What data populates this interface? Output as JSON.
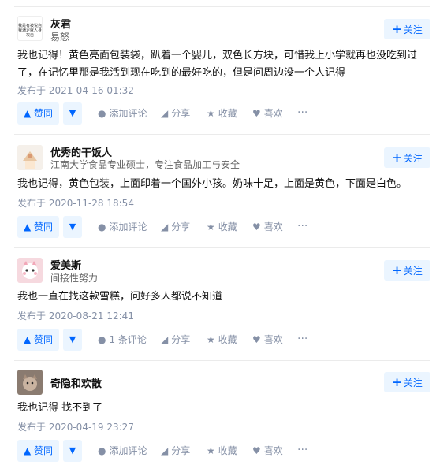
{
  "answers": [
    {
      "author": "灰君",
      "headline": "易怒",
      "avatar_text": "我是有被说自我满足就人身攻击",
      "follow_label": "关注",
      "content": "我也记得！黄色亮面包装袋，趴着一个婴儿，双色长方块，可惜我上小学就再也没吃到过了，在记忆里那是我活到现在吃到的最好吃的，但是问周边没一个人记得",
      "time": "发布于 2021-04-16 01:32",
      "vote_label": "赞同",
      "comment_label": "添加评论",
      "share_label": "分享",
      "collect_label": "收藏",
      "like_label": "喜欢",
      "more_label": "···"
    },
    {
      "author": "优秀的干饭人",
      "headline": "江南大学食品专业硕士，专注食品加工与安全",
      "follow_label": "关注",
      "content": "我也记得，黄色包装，上面印着一个国外小孩。奶味十足，上面是黄色，下面是白色。",
      "time": "发布于 2020-11-28 18:54",
      "vote_label": "赞同",
      "comment_label": "添加评论",
      "share_label": "分享",
      "collect_label": "收藏",
      "like_label": "喜欢",
      "more_label": "···"
    },
    {
      "author": "爱美斯",
      "headline": "间接性努力",
      "follow_label": "关注",
      "content": "我也一直在找这款雪糕，问好多人都说不知道",
      "time": "发布于 2020-08-21 12:41",
      "vote_label": "赞同",
      "comment_label": "1 条评论",
      "share_label": "分享",
      "collect_label": "收藏",
      "like_label": "喜欢",
      "more_label": "···"
    },
    {
      "author": "奇隐和欢散",
      "headline": "",
      "follow_label": "关注",
      "content": "我也记得 找不到了",
      "time": "发布于 2020-04-19 23:27",
      "vote_label": "赞同",
      "comment_label": "添加评论",
      "share_label": "分享",
      "collect_label": "收藏",
      "like_label": "喜欢",
      "more_label": "···"
    }
  ],
  "icons": {
    "vote_up": "up-triangle-icon",
    "vote_down": "down-triangle-icon",
    "comment": "comment-bubble-icon",
    "share": "paper-plane-icon",
    "collect": "star-icon",
    "like": "heart-icon"
  },
  "colors": {
    "accent": "#0066ff",
    "accent_bg": "#ebf5ff",
    "meta_text": "#8590a6"
  }
}
